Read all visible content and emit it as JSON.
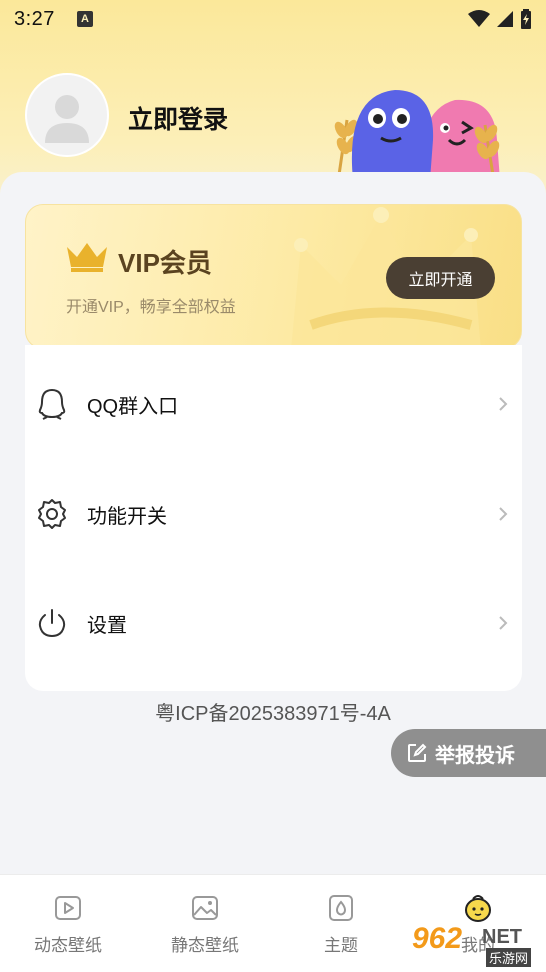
{
  "status_bar": {
    "time": "3:27",
    "notification_letter": "A"
  },
  "profile": {
    "login_label": "立即登录"
  },
  "vip": {
    "title": "VIP会员",
    "subtitle": "开通VIP，畅享全部权益",
    "button_label": "立即开通",
    "brand_color": "#e9b22c"
  },
  "menu": {
    "items": [
      {
        "label": "QQ群入口",
        "icon": "qq-icon"
      },
      {
        "label": "功能开关",
        "icon": "gear-icon"
      },
      {
        "label": "设置",
        "icon": "power-icon"
      }
    ]
  },
  "icp": "粤ICP备2025383971号-4A",
  "report": {
    "label": "举报投诉",
    "icon": "edit-icon"
  },
  "bottom_nav": {
    "items": [
      {
        "label": "动态壁纸",
        "icon": "video-icon"
      },
      {
        "label": "静态壁纸",
        "icon": "image-icon"
      },
      {
        "label": "主题",
        "icon": "theme-icon"
      },
      {
        "label": "我的",
        "icon": "profile-face-icon"
      }
    ]
  },
  "watermark": {
    "brand": "962",
    "suffix": "NET",
    "site": "乐游网"
  }
}
